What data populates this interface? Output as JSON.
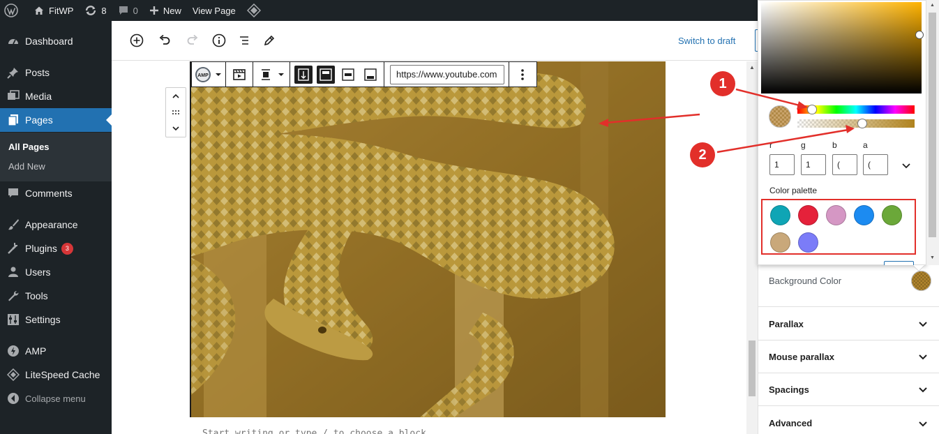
{
  "admin_bar": {
    "site_name": "FitWP",
    "updates_count": "8",
    "comments_count": "0",
    "new_label": "New",
    "view_page_label": "View Page"
  },
  "sidebar": {
    "items": [
      {
        "label": "Dashboard",
        "icon": "dashboard-icon"
      },
      {
        "label": "Posts",
        "icon": "pin-icon"
      },
      {
        "label": "Media",
        "icon": "media-icon"
      },
      {
        "label": "Pages",
        "icon": "pages-icon"
      },
      {
        "label": "Comments",
        "icon": "comment-icon"
      },
      {
        "label": "Appearance",
        "icon": "brush-icon"
      },
      {
        "label": "Plugins",
        "icon": "plug-icon",
        "badge": "3"
      },
      {
        "label": "Users",
        "icon": "user-icon"
      },
      {
        "label": "Tools",
        "icon": "wrench-icon"
      },
      {
        "label": "Settings",
        "icon": "settings-icon"
      },
      {
        "label": "AMP",
        "icon": "amp-icon"
      },
      {
        "label": "LiteSpeed Cache",
        "icon": "diamond-icon"
      },
      {
        "label": "Collapse menu",
        "icon": "collapse-icon"
      }
    ],
    "submenu": [
      "All Pages",
      "Add New"
    ]
  },
  "editor": {
    "switch_to_draft": "Switch to draft",
    "url_value": "https://www.youtube.com",
    "amp_label": "AMP",
    "start_text": "Start writing or type / to choose a block"
  },
  "markers": [
    "1",
    "2"
  ],
  "picker": {
    "labels": [
      "r",
      "g",
      "b",
      "a"
    ],
    "values": [
      "1",
      "1",
      "(",
      "("
    ],
    "palette_label": "Color palette",
    "palette": [
      "#0fa5b5",
      "#e5213a",
      "#d597c4",
      "#1c8bf1",
      "#6ba839",
      "#c9a87a",
      "#7b7cf8"
    ]
  },
  "panel": {
    "background_color_label": "Background Color",
    "sections": [
      "Parallax",
      "Mouse parallax",
      "Spacings",
      "Advanced"
    ]
  }
}
